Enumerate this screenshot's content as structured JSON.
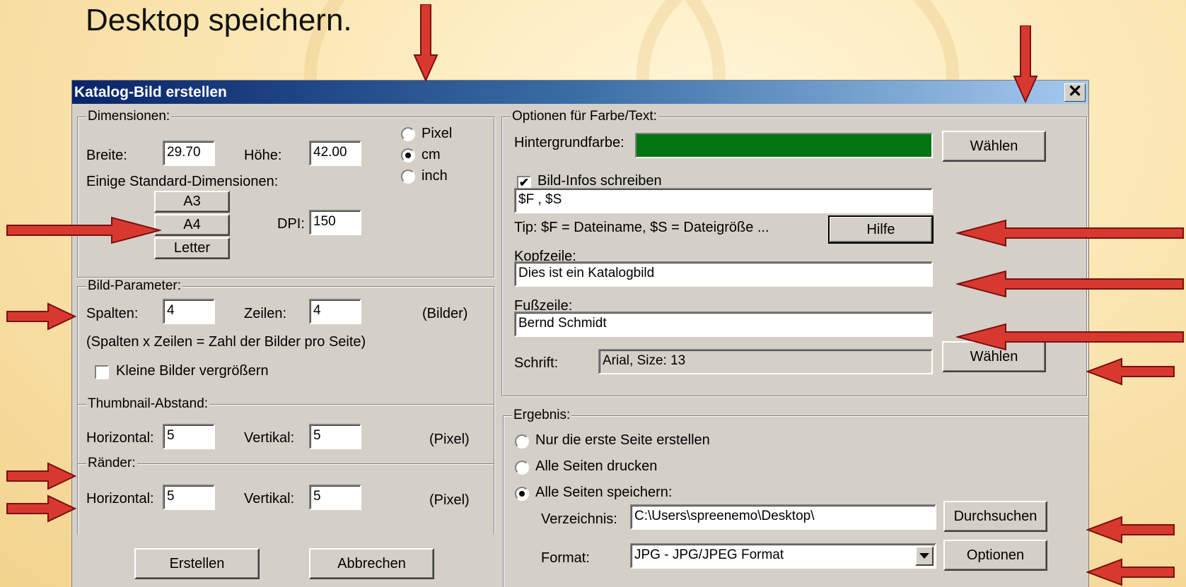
{
  "slide": {
    "title": "Desktop speichern."
  },
  "dialog": {
    "title": "Katalog-Bild erstellen",
    "close_label": "✕",
    "dimensions": {
      "legend": "Dimensionen:",
      "width_label": "Breite:",
      "width_value": "29.70",
      "height_label": "Höhe:",
      "height_value": "42.00",
      "units": [
        {
          "label": "Pixel",
          "checked": false
        },
        {
          "label": "cm",
          "checked": true
        },
        {
          "label": "inch",
          "checked": false
        }
      ],
      "presets_label": "Einige Standard-Dimensionen:",
      "presets": [
        "A3",
        "A4",
        "Letter"
      ],
      "dpi_label": "DPI:",
      "dpi_value": "150"
    },
    "params": {
      "legend": "Bild-Parameter:",
      "cols_label": "Spalten:",
      "cols_value": "4",
      "rows_label": "Zeilen:",
      "rows_value": "4",
      "unit_label": "(Bilder)",
      "hint": "(Spalten x Zeilen = Zahl der Bilder pro Seite)",
      "enlarge_label": "Kleine Bilder vergrößern",
      "enlarge_checked": false
    },
    "spacing": {
      "legend": "Thumbnail-Abstand:",
      "h_label": "Horizontal:",
      "h_value": "5",
      "v_label": "Vertikal:",
      "v_value": "5",
      "unit": "(Pixel)"
    },
    "margins": {
      "legend": "Ränder:",
      "h_label": "Horizontal:",
      "h_value": "5",
      "v_label": "Vertikal:",
      "v_value": "5",
      "unit": "(Pixel)"
    },
    "actions": {
      "create": "Erstellen",
      "cancel": "Abbrechen"
    },
    "options": {
      "legend": "Optionen für Farbe/Text:",
      "bg_label": "Hintergrundfarbe:",
      "bg_color": "#027412",
      "choose_label": "Wählen",
      "info_label": "Bild-Infos schreiben",
      "info_checked": true,
      "info_value": "$F , $S",
      "tip": "Tip: $F = Dateiname, $S = Dateigröße ...",
      "help_label": "Hilfe",
      "header_label": "Kopfzeile:",
      "header_value": "Dies ist ein Katalogbild",
      "footer_label": "Fußzeile:",
      "footer_value": "Bernd Schmidt",
      "font_label": "Schrift:",
      "font_value": "Arial, Size: 13",
      "font_choose_label": "Wählen"
    },
    "result": {
      "legend": "Ergebnis:",
      "choices": [
        {
          "label": "Nur die erste Seite erstellen",
          "checked": false
        },
        {
          "label": "Alle Seiten drucken",
          "checked": false
        },
        {
          "label": "Alle Seiten speichern:",
          "checked": true
        }
      ],
      "dir_label": "Verzeichnis:",
      "dir_value": "C:\\Users\\spreenemo\\Desktop\\",
      "browse_label": "Durchsuchen",
      "format_label": "Format:",
      "format_value": "JPG - JPG/JPEG Format",
      "options_label": "Optionen"
    }
  },
  "colors": {
    "arrow_fill": "#d8392f",
    "arrow_stroke": "#7a1010",
    "titlebar_start": "#0a246a",
    "titlebar_end": "#a6caf0"
  }
}
